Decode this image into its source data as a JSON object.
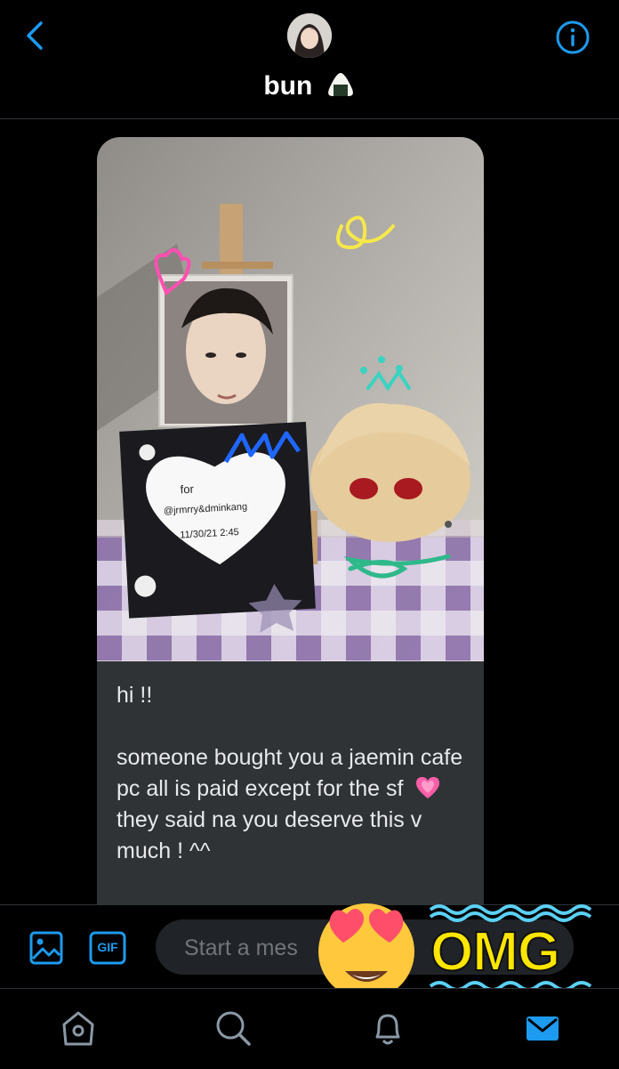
{
  "header": {
    "contact_name": "bun",
    "name_emoji": "rice-ball",
    "back_icon": "chevron-left-icon",
    "info_icon": "info-icon"
  },
  "message": {
    "image_alt": "photocard on easel with heart card and plush",
    "photo_card_text": {
      "line1": "for",
      "line2": "@jrmrry&dminkang",
      "line3": "11/30/21 2:45"
    },
    "paragraphs": [
      "hi !!",
      "someone bought you a jaemin cafe pc all is paid except for the sf",
      "they said na you deserve this v much ! ^^"
    ]
  },
  "composer": {
    "placeholder": "Start a mes",
    "gif_label": "GIF",
    "sticker_text": "OMG"
  },
  "nav": {
    "items": [
      "home",
      "search",
      "notifications",
      "messages"
    ],
    "active": "messages"
  },
  "colors": {
    "accent": "#1d9bf0",
    "bubble": "#2f3336",
    "background": "#000000",
    "sticker_yellow": "#ffe600",
    "sticker_blue": "#5bd0f5"
  }
}
